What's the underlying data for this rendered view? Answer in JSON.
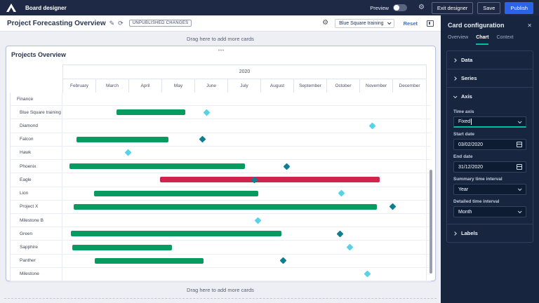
{
  "topbar": {
    "app_title": "Board designer",
    "preview_label": "Preview",
    "exit_label": "Exit designer",
    "save_label": "Save",
    "publish_label": "Publish"
  },
  "toolbar": {
    "title": "Project Forecasting Overview",
    "badge": "UNPUBLISHED CHANGES",
    "context_selector": "Blue Square training",
    "reset_label": "Reset"
  },
  "board": {
    "drop_hint_top": "Drag here to add more cards",
    "drop_hint_bottom": "Drag here to add more cards"
  },
  "panel": {
    "title": "Card configuration",
    "tabs": [
      {
        "label": "Overview",
        "active": false
      },
      {
        "label": "Chart",
        "active": true
      },
      {
        "label": "Context",
        "active": false
      }
    ],
    "sections": {
      "data": "Data",
      "series": "Series",
      "axis": "Axis",
      "labels": "Labels"
    },
    "fields": {
      "time_axis_label": "Time axis",
      "time_axis_value": "Fixed",
      "start_date_label": "Start date",
      "start_date_value": "03/02/2020",
      "end_date_label": "End date",
      "end_date_value": "31/12/2020",
      "summary_label": "Summary time interval",
      "summary_value": "Year",
      "detailed_label": "Detailed time interval",
      "detailed_value": "Month"
    },
    "accent_color": "#00bfa0"
  },
  "chart_data": {
    "type": "gantt",
    "title": "Projects Overview",
    "year": "2020",
    "months": [
      "February",
      "March",
      "April",
      "May",
      "June",
      "July",
      "August",
      "September",
      "October",
      "November",
      "December"
    ],
    "colors": {
      "bar_green": "#089b60",
      "bar_red": "#d0244d",
      "milestone_dark": "#0e7e91",
      "milestone_light": "#58d3e5"
    },
    "rows": [
      {
        "label": "Finance",
        "indent": 0
      },
      {
        "label": "Blue Square training",
        "indent": 1,
        "bar": {
          "start_pct": 14.8,
          "end_pct": 33.7,
          "color": "green"
        },
        "milestone": {
          "pos_pct": 39.7,
          "tone": "light"
        }
      },
      {
        "label": "Diamond",
        "indent": 1,
        "milestone": {
          "pos_pct": 85.2,
          "tone": "light"
        }
      },
      {
        "label": "Falcon",
        "indent": 1,
        "bar": {
          "start_pct": 3.9,
          "end_pct": 29.1,
          "color": "green"
        },
        "milestone": {
          "pos_pct": 38.5,
          "tone": "dark"
        }
      },
      {
        "label": "Hawk",
        "indent": 1,
        "milestone": {
          "pos_pct": 18.1,
          "tone": "light"
        }
      },
      {
        "label": "Phoenix",
        "indent": 1,
        "bar": {
          "start_pct": 1.9,
          "end_pct": 50.1,
          "color": "green"
        },
        "milestone": {
          "pos_pct": 61.7,
          "tone": "dark"
        }
      },
      {
        "label": "Eagle",
        "indent": 1,
        "bar": {
          "start_pct": 26.8,
          "end_pct": 87.3,
          "color": "red"
        },
        "milestone": {
          "pos_pct": 52.8,
          "tone": "dark"
        }
      },
      {
        "label": "Lion",
        "indent": 1,
        "bar": {
          "start_pct": 8.7,
          "end_pct": 53.9,
          "color": "green"
        },
        "milestone": {
          "pos_pct": 76.7,
          "tone": "light"
        }
      },
      {
        "label": "Project X",
        "indent": 1,
        "bar": {
          "start_pct": 3.1,
          "end_pct": 86.5,
          "color": "green"
        },
        "milestone": {
          "pos_pct": 90.8,
          "tone": "dark"
        }
      },
      {
        "label": "Milestone B",
        "indent": 1,
        "milestone": {
          "pos_pct": 53.8,
          "tone": "light"
        }
      },
      {
        "label": "Green",
        "indent": 1,
        "bar": {
          "start_pct": 2.3,
          "end_pct": 60.3,
          "color": "green"
        },
        "milestone": {
          "pos_pct": 76.3,
          "tone": "dark"
        }
      },
      {
        "label": "Sapphire",
        "indent": 1,
        "bar": {
          "start_pct": 2.7,
          "end_pct": 30.2,
          "color": "green"
        },
        "milestone": {
          "pos_pct": 79.0,
          "tone": "light"
        }
      },
      {
        "label": "Panther",
        "indent": 1,
        "bar": {
          "start_pct": 8.9,
          "end_pct": 38.9,
          "color": "green"
        },
        "milestone": {
          "pos_pct": 60.7,
          "tone": "dark"
        }
      },
      {
        "label": "Milestone",
        "indent": 1,
        "milestone": {
          "pos_pct": 83.8,
          "tone": "light"
        }
      }
    ]
  }
}
